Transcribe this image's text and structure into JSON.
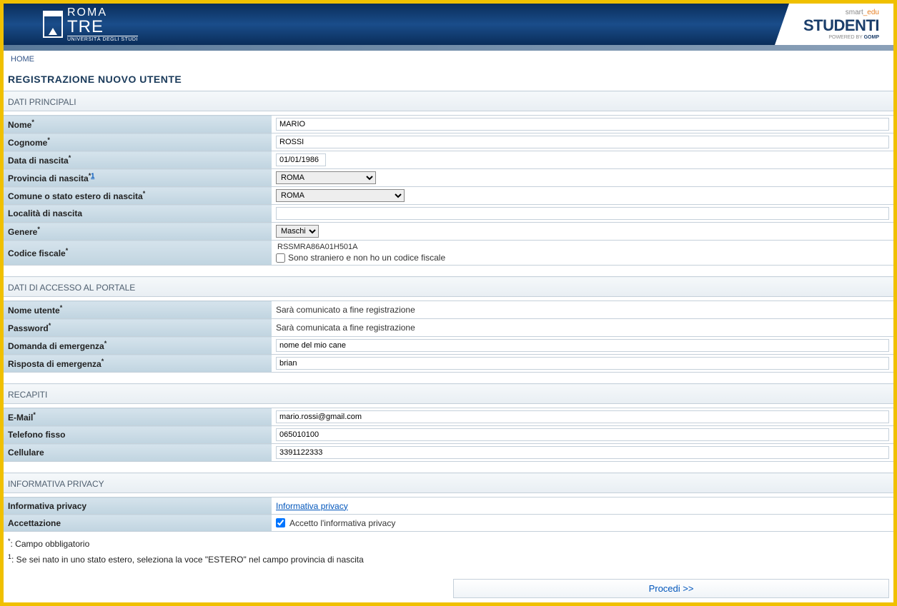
{
  "header": {
    "logo_top": "ROMA",
    "logo_mid": "TRE",
    "logo_sub": "UNIVERSITÀ DEGLI STUDI",
    "smart": "smart",
    "edu": "_edu",
    "studenti": "STUDENTI",
    "powered": "POWERED BY ",
    "gomp": "GOMP"
  },
  "breadcrumb": {
    "home": "HOME"
  },
  "page_title": "REGISTRAZIONE NUOVO UTENTE",
  "sections": {
    "dati_principali": "DATI PRINCIPALI",
    "dati_accesso": "DATI DI ACCESSO AL PORTALE",
    "recapiti": "RECAPITI",
    "privacy": "INFORMATIVA PRIVACY"
  },
  "labels": {
    "nome": "Nome",
    "cognome": "Cognome",
    "data_nascita": "Data di nascita",
    "provincia_nascita": "Provincia di nascita",
    "comune_nascita": "Comune o stato estero di nascita",
    "localita_nascita": "Località di nascita",
    "genere": "Genere",
    "codice_fiscale": "Codice fiscale",
    "nome_utente": "Nome utente",
    "password": "Password",
    "domanda_emergenza": "Domanda di emergenza",
    "risposta_emergenza": "Risposta di emergenza",
    "email": "E-Mail",
    "telefono_fisso": "Telefono fisso",
    "cellulare": "Cellulare",
    "informativa_privacy": "Informativa privacy",
    "accettazione": "Accettazione"
  },
  "values": {
    "nome": "MARIO",
    "cognome": "ROSSI",
    "data_nascita": "01/01/1986",
    "provincia": "ROMA",
    "comune": "ROMA",
    "localita": "",
    "genere": "Maschio",
    "codice_fiscale": "RSSMRA86A01H501A",
    "straniero_label": "Sono straniero e non ho un codice fiscale",
    "nome_utente_msg": "Sarà comunicato a fine registrazione",
    "password_msg": "Sarà comunicata a fine registrazione",
    "domanda_emergenza": "nome del mio cane",
    "risposta_emergenza": "brian",
    "email": "mario.rossi@gmail.com",
    "telefono_fisso": "065010100",
    "cellulare": "3391122333",
    "privacy_link": "Informativa privacy",
    "accetto_label": "Accetto l'informativa privacy"
  },
  "footnotes": {
    "required": ": Campo obbligatorio",
    "estero": ": Se sei nato in uno stato estero, seleziona la voce \"ESTERO\" nel campo provincia di nascita"
  },
  "proceed": "Procedi >>"
}
